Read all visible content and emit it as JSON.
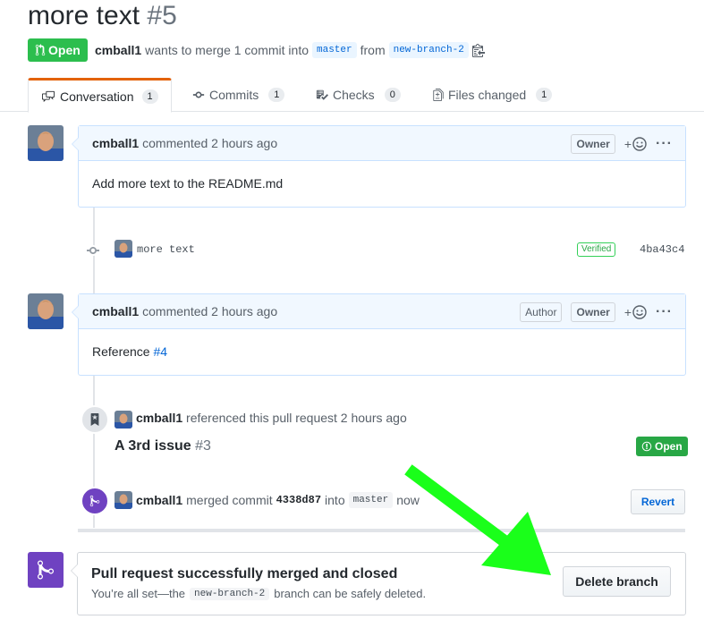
{
  "pr": {
    "title": "more text",
    "number": "#5",
    "state": "Open",
    "author": "cmball1",
    "merge_text": "wants to merge 1 commit into",
    "base_branch": "master",
    "from_text": "from",
    "head_branch": "new-branch-2"
  },
  "tabs": [
    {
      "label": "Conversation",
      "count": "1"
    },
    {
      "label": "Commits",
      "count": "1"
    },
    {
      "label": "Checks",
      "count": "0"
    },
    {
      "label": "Files changed",
      "count": "1"
    }
  ],
  "comments": [
    {
      "author": "cmball1",
      "action": "commented 2 hours ago",
      "labels": [
        "Owner"
      ],
      "body": "Add more text to the README.md",
      "add_reaction": "+"
    },
    {
      "author": "cmball1",
      "action": "commented 2 hours ago",
      "labels": [
        "Author",
        "Owner"
      ],
      "body_prefix": "Reference",
      "body_link": "#4",
      "add_reaction": "+"
    }
  ],
  "commit": {
    "message": "more text",
    "verified": "Verified",
    "sha": "4ba43c4"
  },
  "reference_event": {
    "author": "cmball1",
    "text": "referenced this pull request 2 hours ago",
    "issue_title": "A 3rd issue",
    "issue_number": "#3",
    "issue_state": "Open"
  },
  "merge_event": {
    "author": "cmball1",
    "text_before": "merged commit",
    "sha": "4338d87",
    "text_into": "into",
    "branch": "master",
    "time": "now",
    "revert_label": "Revert"
  },
  "merged_box": {
    "heading": "Pull request successfully merged and closed",
    "text_before": "You’re all set—the",
    "branch": "new-branch-2",
    "text_after": "branch can be safely deleted.",
    "delete_label": "Delete branch"
  },
  "colors": {
    "open_green": "#2cbe4e",
    "merged_purple": "#6f42c1",
    "link_blue": "#0366d6",
    "arrow_green": "#1aff1a"
  }
}
